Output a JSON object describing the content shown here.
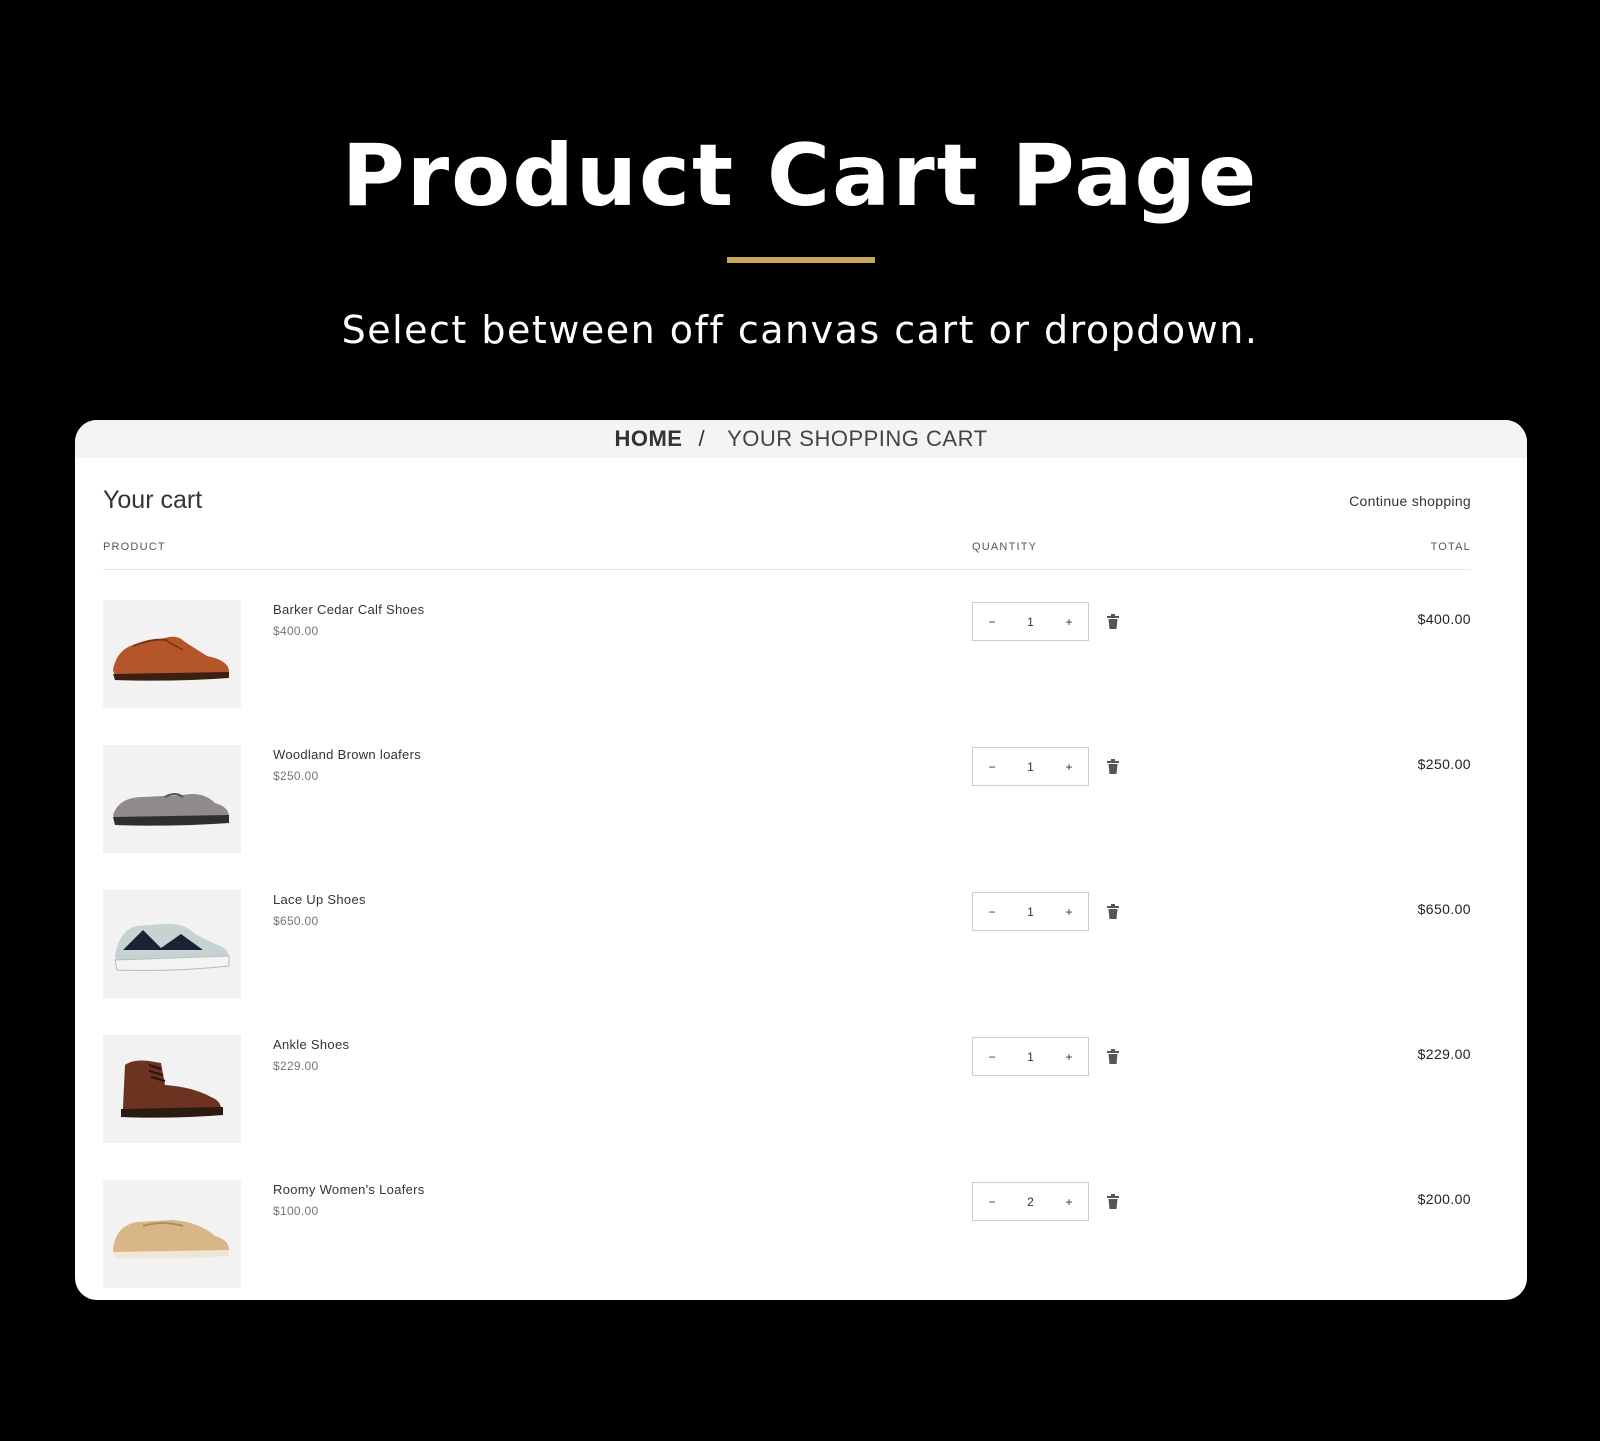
{
  "hero": {
    "title": "Product Cart Page",
    "subtitle": "Select between off canvas cart or dropdown.",
    "accent_color": "#c8a35a"
  },
  "breadcrumb": {
    "home": "HOME",
    "separator": "/",
    "current": "YOUR SHOPPING CART"
  },
  "cart": {
    "title": "Your cart",
    "continue_label": "Continue shopping",
    "headers": {
      "product": "PRODUCT",
      "quantity": "QUANTITY",
      "total": "TOTAL"
    },
    "items": [
      {
        "name": "Barker Cedar Calf Shoes",
        "price": "$400.00",
        "qty": "1",
        "total": "$400.00",
        "image": "brown-oxford-shoe"
      },
      {
        "name": "Woodland Brown loafers",
        "price": "$250.00",
        "qty": "1",
        "total": "$250.00",
        "image": "grey-loafer"
      },
      {
        "name": "Lace Up Shoes",
        "price": "$650.00",
        "qty": "1",
        "total": "$650.00",
        "image": "sneaker"
      },
      {
        "name": "Ankle Shoes",
        "price": "$229.00",
        "qty": "1",
        "total": "$229.00",
        "image": "ankle-boot"
      },
      {
        "name": "Roomy Women's Loafers",
        "price": "$100.00",
        "qty": "2",
        "total": "$200.00",
        "image": "tan-loafer"
      }
    ],
    "stepper": {
      "minus": "−",
      "plus": "+"
    }
  }
}
